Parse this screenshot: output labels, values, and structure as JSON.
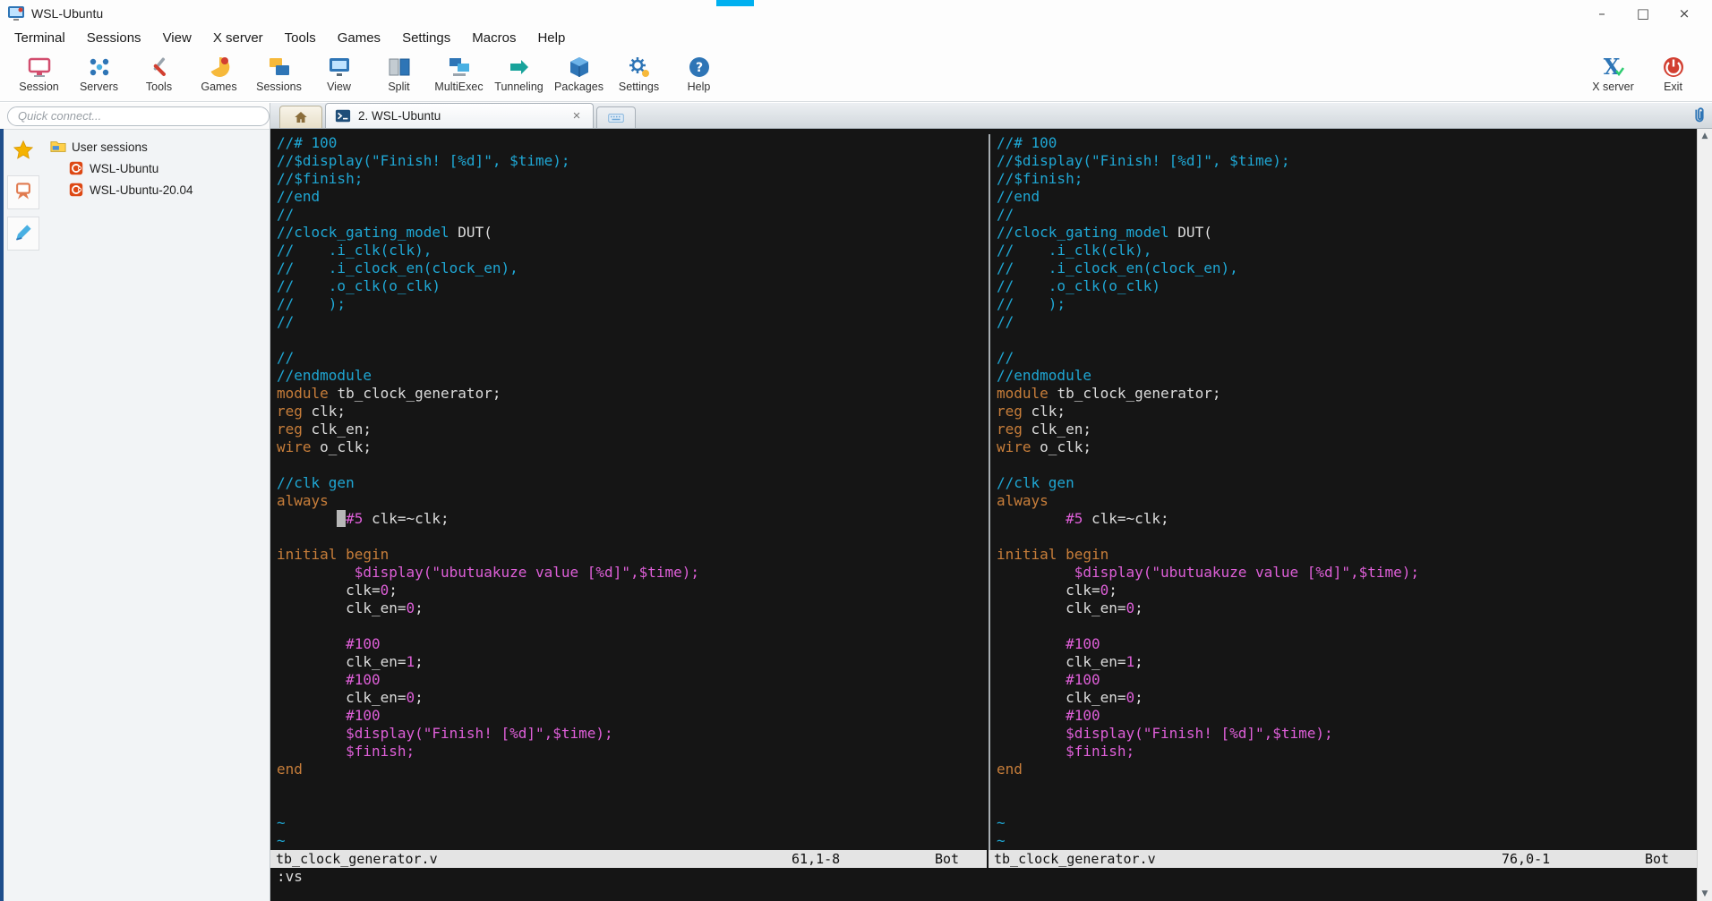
{
  "window": {
    "title": "WSL-Ubuntu",
    "accent_bar_color": "#00b0f0",
    "controls": [
      {
        "name": "minimize",
        "glyph": "–"
      },
      {
        "name": "maximize",
        "glyph": "□"
      },
      {
        "name": "close",
        "glyph": "×"
      }
    ]
  },
  "menu": {
    "items": [
      "Terminal",
      "Sessions",
      "View",
      "X server",
      "Tools",
      "Games",
      "Settings",
      "Macros",
      "Help"
    ]
  },
  "toolbar": {
    "items": [
      {
        "label": "Session",
        "icon": "session-icon"
      },
      {
        "label": "Servers",
        "icon": "servers-icon"
      },
      {
        "label": "Tools",
        "icon": "tools-icon"
      },
      {
        "label": "Games",
        "icon": "games-icon"
      },
      {
        "label": "Sessions",
        "icon": "sessions-icon"
      },
      {
        "label": "View",
        "icon": "view-icon"
      },
      {
        "label": "Split",
        "icon": "split-icon"
      },
      {
        "label": "MultiExec",
        "icon": "multiexec-icon"
      },
      {
        "label": "Tunneling",
        "icon": "tunneling-icon"
      },
      {
        "label": "Packages",
        "icon": "packages-icon"
      },
      {
        "label": "Settings",
        "icon": "settings-icon"
      },
      {
        "label": "Help",
        "icon": "help-icon"
      }
    ],
    "right_items": [
      {
        "label": "X server",
        "icon": "xserver-icon"
      },
      {
        "label": "Exit",
        "icon": "exit-icon"
      }
    ]
  },
  "sidebar": {
    "quick_connect_placeholder": "Quick connect...",
    "rail": [
      {
        "icon": "star-icon"
      },
      {
        "icon": "remote-session-icon"
      },
      {
        "icon": "macros-pen-icon"
      }
    ],
    "tree_root": "User sessions",
    "sessions": [
      {
        "label": "WSL-Ubuntu"
      },
      {
        "label": "WSL-Ubuntu-20.04"
      }
    ]
  },
  "tabs": {
    "active_label": "2. WSL-Ubuntu",
    "close": "×"
  },
  "terminal": {
    "command_line": ":vs",
    "left_status": {
      "file": "tb_clock_generator.v",
      "ruler": "61,1-8",
      "pos": "Bot"
    },
    "right_status": {
      "file": "tb_clock_generator.v",
      "ruler": "76,0-1",
      "pos": "Bot"
    },
    "cursor": {
      "line_index": 21,
      "before_cols": 7
    },
    "colors": {
      "comment": "#1fa7d4",
      "keyword": "#c87e3a",
      "magenta": "#de5fd8",
      "text": "#dcdcdc",
      "background": "#151515"
    },
    "lines": [
      [
        [
          "c",
          "//# 100"
        ]
      ],
      [
        [
          "c",
          "//$display(\"Finish! [%d]\", $time);"
        ]
      ],
      [
        [
          "c",
          "//$finish;"
        ]
      ],
      [
        [
          "c",
          "//end"
        ]
      ],
      [
        [
          "c",
          "//"
        ]
      ],
      [
        [
          "c",
          "//clock_gating_model "
        ],
        [
          "w",
          "DUT("
        ]
      ],
      [
        [
          "c",
          "//    .i_clk(clk),"
        ]
      ],
      [
        [
          "c",
          "//    .i_clock_en(clock_en),"
        ]
      ],
      [
        [
          "c",
          "//    .o_clk(o_clk)"
        ]
      ],
      [
        [
          "c",
          "//    );"
        ]
      ],
      [
        [
          "c",
          "//"
        ]
      ],
      [],
      [
        [
          "c",
          "//"
        ]
      ],
      [
        [
          "c",
          "//endmodule"
        ]
      ],
      [
        [
          "o",
          "module "
        ],
        [
          "w",
          "tb_clock_generator;"
        ]
      ],
      [
        [
          "o",
          "reg "
        ],
        [
          "w",
          "clk;"
        ]
      ],
      [
        [
          "o",
          "reg "
        ],
        [
          "w",
          "clk_en;"
        ]
      ],
      [
        [
          "o",
          "wire "
        ],
        [
          "w",
          "o_clk;"
        ]
      ],
      [],
      [
        [
          "c",
          "//clk gen"
        ]
      ],
      [
        [
          "o",
          "always"
        ]
      ],
      [
        [
          "w",
          "        "
        ],
        [
          "m",
          "#5"
        ],
        [
          "w",
          " clk=~clk;"
        ]
      ],
      [],
      [
        [
          "o",
          "initial begin"
        ]
      ],
      [
        [
          "w",
          "         "
        ],
        [
          "m",
          "$display(\"ubutuakuze value [%d]\",$time);"
        ]
      ],
      [
        [
          "w",
          "        clk="
        ],
        [
          "m",
          "0"
        ],
        [
          "w",
          ";"
        ]
      ],
      [
        [
          "w",
          "        clk_en="
        ],
        [
          "m",
          "0"
        ],
        [
          "w",
          ";"
        ]
      ],
      [],
      [
        [
          "w",
          "        "
        ],
        [
          "m",
          "#100"
        ]
      ],
      [
        [
          "w",
          "        clk_en="
        ],
        [
          "m",
          "1"
        ],
        [
          "w",
          ";"
        ]
      ],
      [
        [
          "w",
          "        "
        ],
        [
          "m",
          "#100"
        ]
      ],
      [
        [
          "w",
          "        clk_en="
        ],
        [
          "m",
          "0"
        ],
        [
          "w",
          ";"
        ]
      ],
      [
        [
          "w",
          "        "
        ],
        [
          "m",
          "#100"
        ]
      ],
      [
        [
          "w",
          "        "
        ],
        [
          "m",
          "$display(\"Finish! [%d]\",$time);"
        ]
      ],
      [
        [
          "w",
          "        "
        ],
        [
          "m",
          "$finish;"
        ]
      ],
      [
        [
          "o",
          "end"
        ]
      ],
      [],
      [],
      [
        [
          "c",
          "~"
        ]
      ],
      [
        [
          "c",
          "~"
        ]
      ]
    ]
  }
}
